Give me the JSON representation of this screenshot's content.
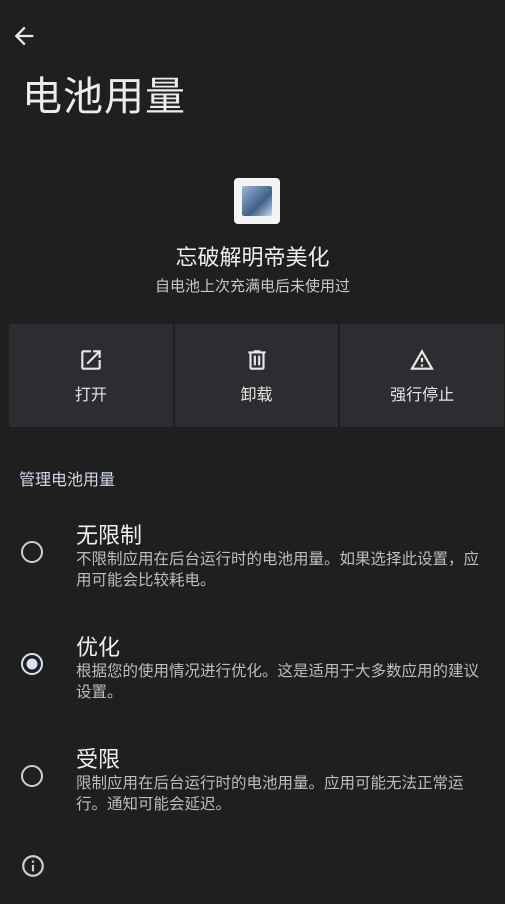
{
  "header": {
    "title": "电池用量"
  },
  "app": {
    "name": "忘破解明帝美化",
    "subtitle": "自电池上次充满电后未使用过"
  },
  "actions": [
    {
      "label": "打开",
      "icon": "open-external-icon"
    },
    {
      "label": "卸载",
      "icon": "trash-icon"
    },
    {
      "label": "强行停止",
      "icon": "warning-icon"
    }
  ],
  "manage": {
    "header": "管理电池用量",
    "options": [
      {
        "title": "无限制",
        "desc": "不限制应用在后台运行时的电池用量。如果选择此设置，应用可能会比较耗电。",
        "selected": false
      },
      {
        "title": "优化",
        "desc": "根据您的使用情况进行优化。这是适用于大多数应用的建议设置。",
        "selected": true
      },
      {
        "title": "受限",
        "desc": "限制应用在后台运行时的电池用量。应用可能无法正常运行。通知可能会延迟。",
        "selected": false
      }
    ]
  },
  "colors": {
    "background": "#1f1f1f",
    "accent": "#d8e3f8",
    "card": "#2c2d30"
  }
}
